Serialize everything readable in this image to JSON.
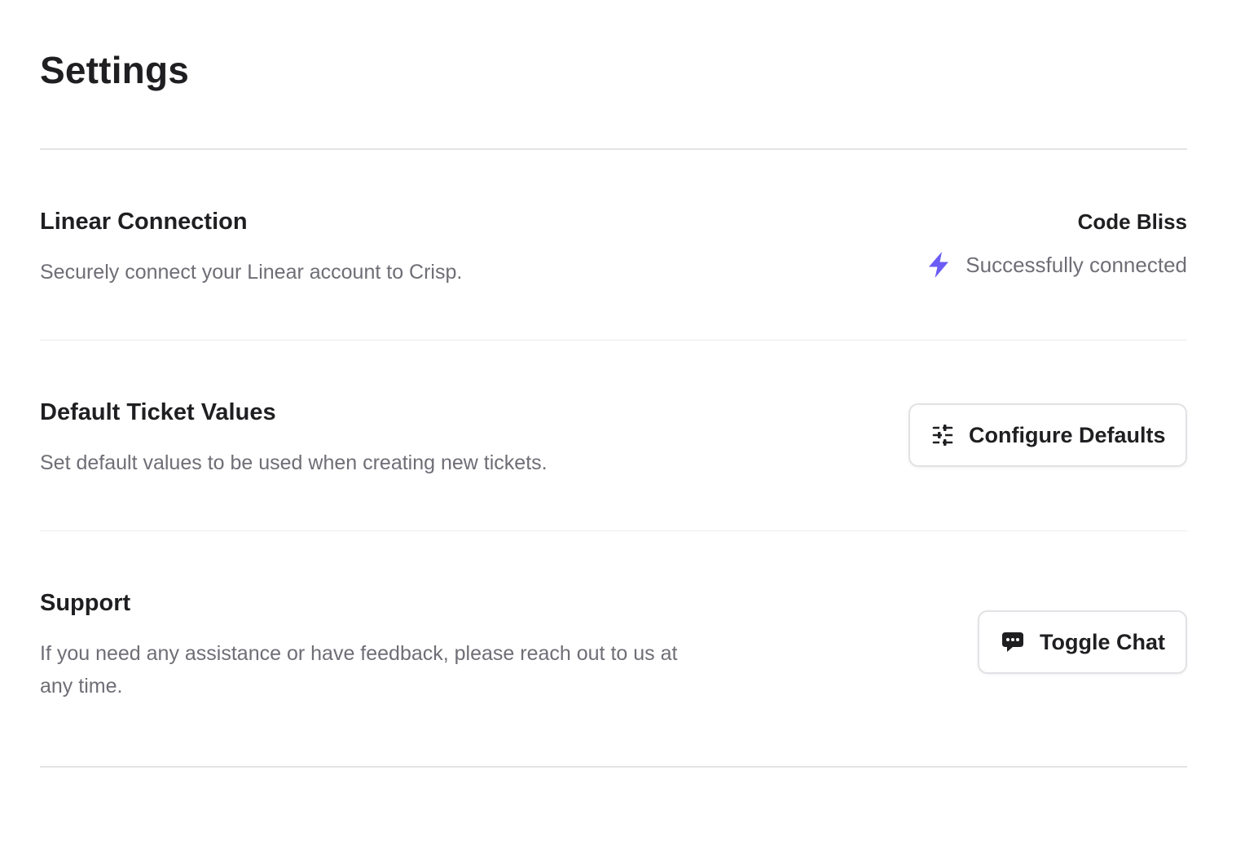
{
  "page": {
    "title": "Settings"
  },
  "sections": {
    "linear": {
      "title": "Linear Connection",
      "description": "Securely connect your Linear account to Crisp.",
      "account_name": "Code Bliss",
      "status_text": "Successfully connected",
      "status_icon": "lightning-bolt-icon",
      "status_color": "#6B5CF6"
    },
    "defaults": {
      "title": "Default Ticket Values",
      "description": "Set default values to be used when creating new tickets.",
      "button_label": "Configure Defaults",
      "button_icon": "sliders-icon"
    },
    "support": {
      "title": "Support",
      "description": "If you need any assistance or have feedback, please reach out to us at any time.",
      "button_label": "Toggle Chat",
      "button_icon": "chat-bubble-icon"
    }
  }
}
